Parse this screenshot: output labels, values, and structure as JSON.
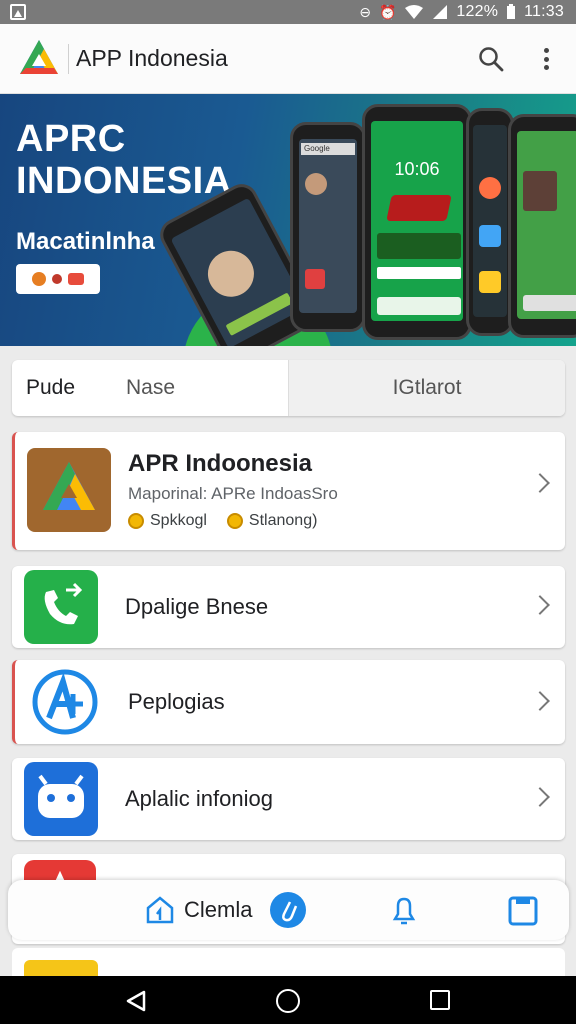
{
  "status_bar": {
    "battery": "122%",
    "time": "11:33"
  },
  "app_bar": {
    "title": "APP Indonesia"
  },
  "banner": {
    "headline_1": "APRC",
    "headline_2": "INDONESIA",
    "subtitle": "Macatinlnha",
    "phone_screen_labels": {
      "time": "10:06",
      "search_tab": "Google"
    }
  },
  "tabs": [
    {
      "label": "Pude"
    },
    {
      "label": "Nase"
    },
    {
      "label": "IGtlarot"
    }
  ],
  "list": [
    {
      "title": "APR Indoonesia",
      "description": "Maporinal: APRe IndoasSro",
      "meta_1": "Spkkogl",
      "meta_2": "Stlanong)"
    },
    {
      "title": "Dpalige Bnese"
    },
    {
      "title": "Peplogias"
    },
    {
      "title": "Aplalic infoniog"
    },
    {
      "title": ""
    }
  ],
  "bottom_bar": {
    "label": "Clemla"
  },
  "colors": {
    "accent_red": "#d9534f",
    "accent_blue": "#1e88e5",
    "banner_start": "#17467f",
    "banner_end": "#14a38c",
    "whatsapp_green": "#25b04a"
  }
}
